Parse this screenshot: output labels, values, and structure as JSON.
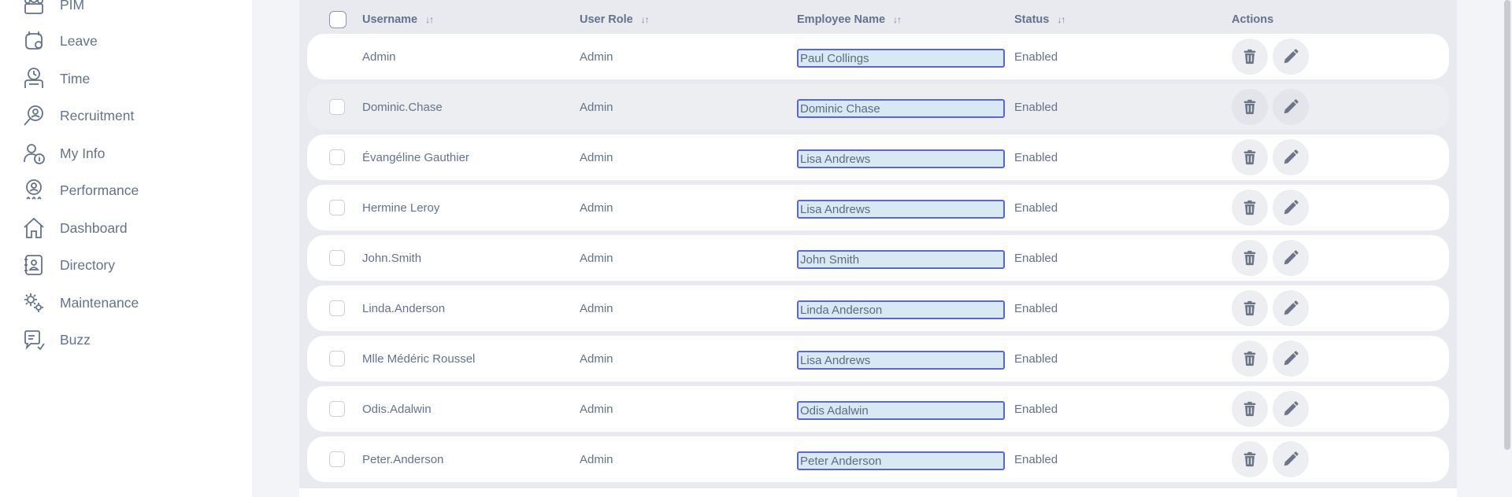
{
  "sidebar": {
    "items": [
      {
        "label": "PIM",
        "icon": "pim-icon"
      },
      {
        "label": "Leave",
        "icon": "leave-icon"
      },
      {
        "label": "Time",
        "icon": "time-icon"
      },
      {
        "label": "Recruitment",
        "icon": "recruitment-icon"
      },
      {
        "label": "My Info",
        "icon": "my-info-icon"
      },
      {
        "label": "Performance",
        "icon": "performance-icon"
      },
      {
        "label": "Dashboard",
        "icon": "dashboard-icon"
      },
      {
        "label": "Directory",
        "icon": "directory-icon"
      },
      {
        "label": "Maintenance",
        "icon": "maintenance-icon"
      },
      {
        "label": "Buzz",
        "icon": "buzz-icon"
      }
    ]
  },
  "table": {
    "headers": {
      "username": "Username",
      "user_role": "User Role",
      "employee_name": "Employee Name",
      "status": "Status",
      "actions": "Actions"
    },
    "rows": [
      {
        "username": "Admin",
        "role": "Admin",
        "employee": "Paul Collings",
        "status": "Enabled",
        "has_checkbox": false
      },
      {
        "username": "Dominic.Chase",
        "role": "Admin",
        "employee": "Dominic Chase",
        "status": "Enabled",
        "has_checkbox": true
      },
      {
        "username": "Évangéline Gauthier",
        "role": "Admin",
        "employee": "Lisa Andrews",
        "status": "Enabled",
        "has_checkbox": true
      },
      {
        "username": "Hermine Leroy",
        "role": "Admin",
        "employee": "Lisa Andrews",
        "status": "Enabled",
        "has_checkbox": true
      },
      {
        "username": "John.Smith",
        "role": "Admin",
        "employee": "John Smith",
        "status": "Enabled",
        "has_checkbox": true
      },
      {
        "username": "Linda.Anderson",
        "role": "Admin",
        "employee": "Linda Anderson",
        "status": "Enabled",
        "has_checkbox": true
      },
      {
        "username": "Mlle Médéric Roussel",
        "role": "Admin",
        "employee": "Lisa Andrews",
        "status": "Enabled",
        "has_checkbox": true
      },
      {
        "username": "Odis.Adalwin",
        "role": "Admin",
        "employee": "Odis Adalwin",
        "status": "Enabled",
        "has_checkbox": true
      },
      {
        "username": "Peter.Anderson",
        "role": "Admin",
        "employee": "Peter Anderson",
        "status": "Enabled",
        "has_checkbox": true
      }
    ]
  },
  "icons": {
    "sort": "sort-icon",
    "delete": "trash-icon",
    "edit": "pencil-icon"
  },
  "colors": {
    "text": "#64728c",
    "highlight_border": "#5a66d8",
    "highlight_fill": "#d8e9f3"
  }
}
